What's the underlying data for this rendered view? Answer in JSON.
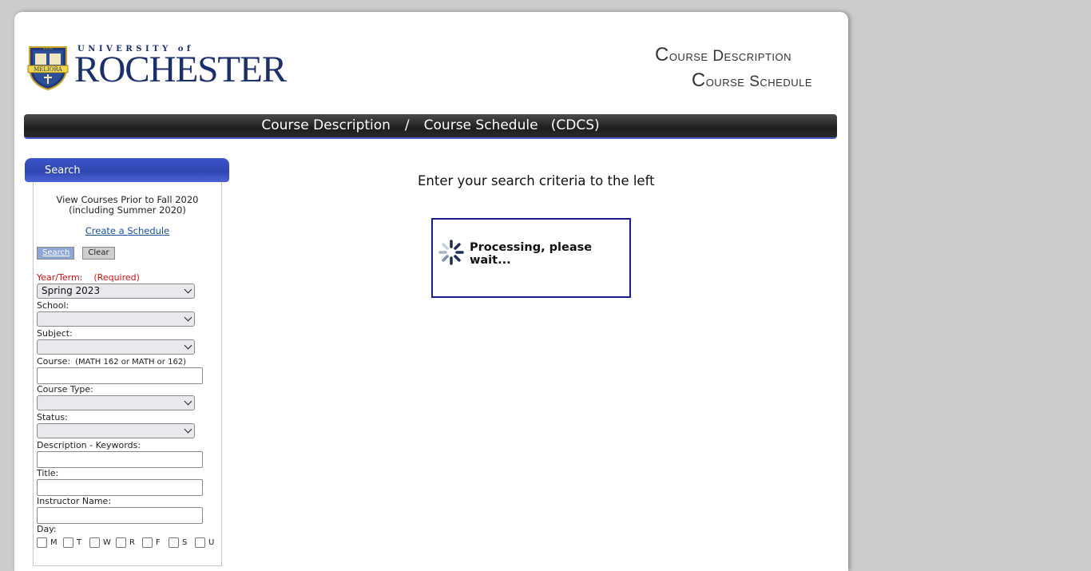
{
  "header": {
    "logo_university": "UNIVERSITY of",
    "logo_name": "ROCHESTER",
    "seal_text": "MELIORA",
    "seal_year": "1850",
    "title_line1": "Course Description",
    "title_line2": "Course Schedule"
  },
  "banner": {
    "part1": "Course Description",
    "separator": "/",
    "part2": "Course Schedule",
    "abbrev": "(CDCS)"
  },
  "sidebar": {
    "tab_label": "Search",
    "prior_line1": "View Courses Prior to Fall 2020",
    "prior_line2": "(including Summer 2020)",
    "create_link": "Create a Schedule",
    "search_button": "Search",
    "clear_button": "Clear",
    "year_term_label": "Year/Term:",
    "required_label": "(Required)",
    "year_term_value": "Spring 2023",
    "school_label": "School:",
    "school_value": "",
    "subject_label": "Subject:",
    "subject_value": "",
    "course_label": "Course:",
    "course_hint": "(MATH 162 or MATH or 162)",
    "course_value": "",
    "course_type_label": "Course Type:",
    "course_type_value": "",
    "status_label": "Status:",
    "status_value": "",
    "keywords_label": "Description - Keywords:",
    "title_label": "Title:",
    "instructor_label": "Instructor Name:",
    "day_label": "Day:",
    "days": [
      "M",
      "T",
      "W",
      "R",
      "F",
      "S",
      "U"
    ]
  },
  "main": {
    "prompt": "Enter your search criteria to the left",
    "processing": "Processing, please wait..."
  },
  "colors": {
    "brand_blue": "#1a2f6b",
    "tab_blue": "#3a54c9",
    "required_red": "#cc1111",
    "modal_border": "#1a1a8c"
  }
}
